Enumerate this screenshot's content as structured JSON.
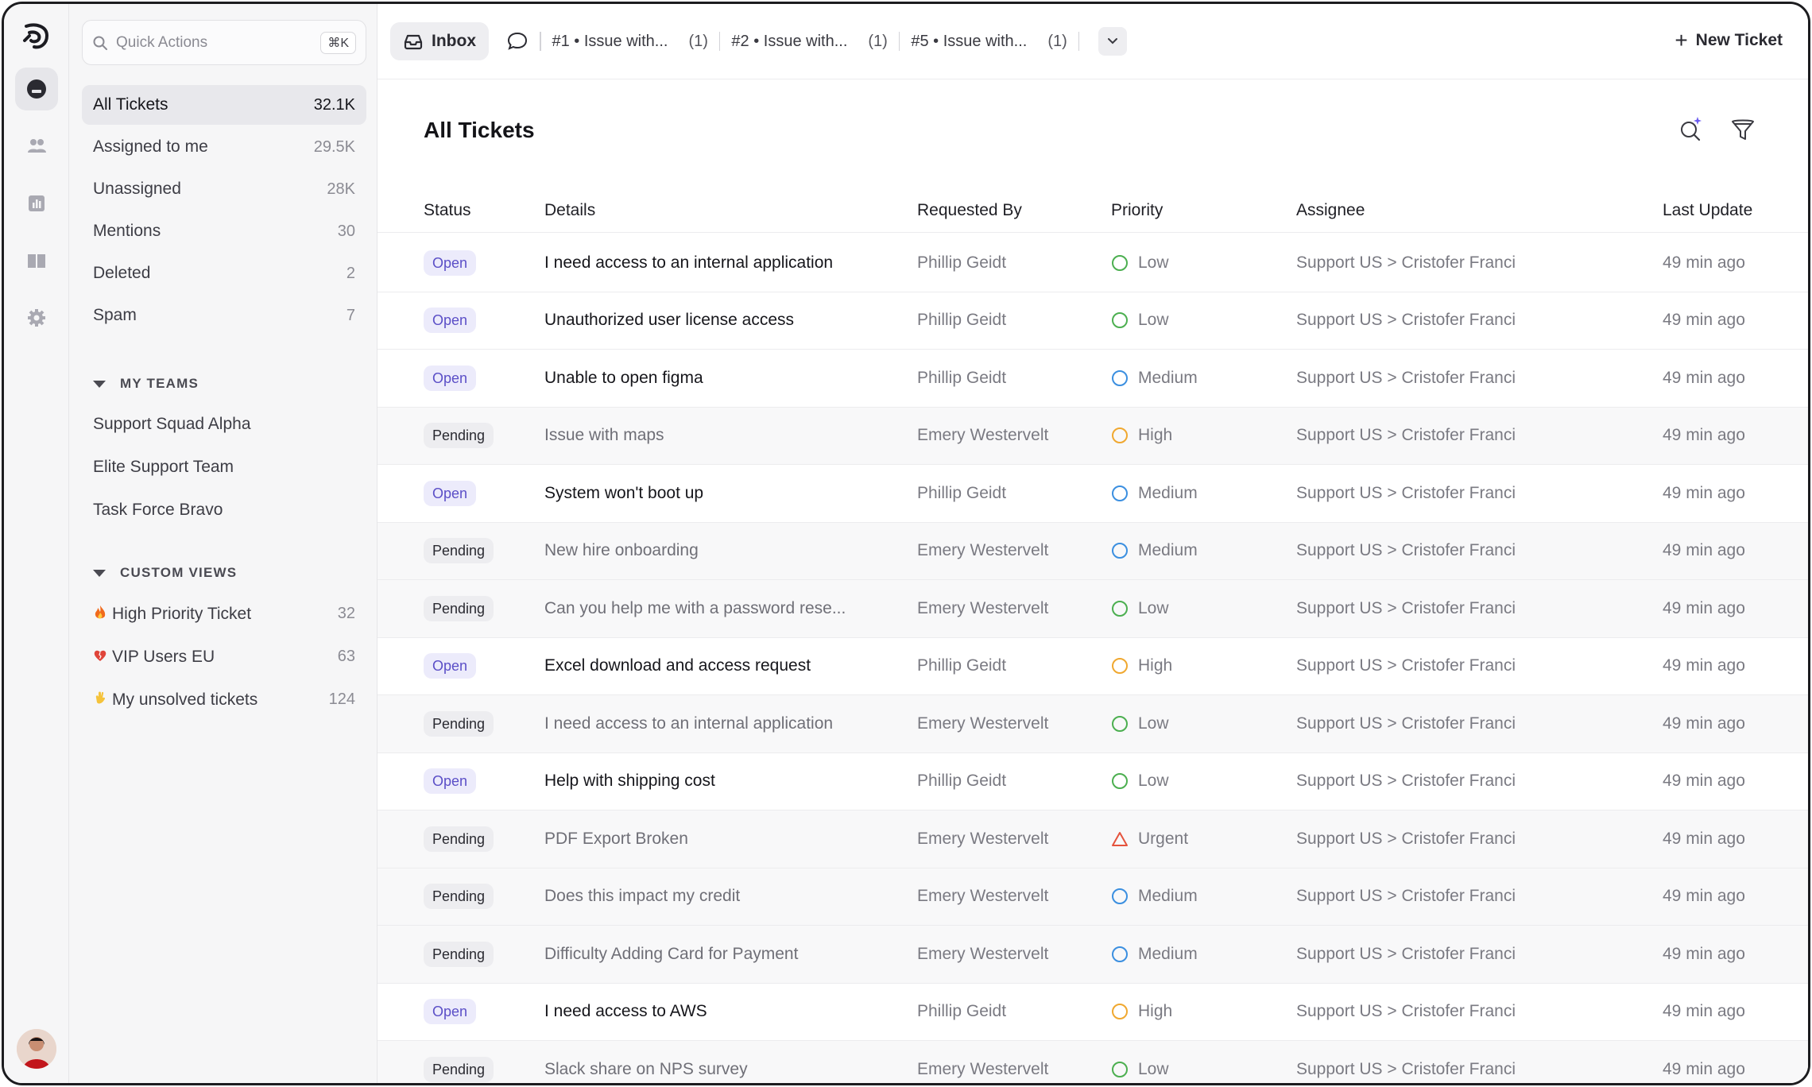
{
  "sidebar": {
    "search_placeholder": "Quick Actions",
    "search_shortcut": "⌘K",
    "items": [
      {
        "label": "All Tickets",
        "count": "32.1K"
      },
      {
        "label": "Assigned to me",
        "count": "29.5K"
      },
      {
        "label": "Unassigned",
        "count": "28K"
      },
      {
        "label": "Mentions",
        "count": "30"
      },
      {
        "label": "Deleted",
        "count": "2"
      },
      {
        "label": "Spam",
        "count": "7"
      }
    ],
    "teams_heading": "MY TEAMS",
    "teams": [
      "Support Squad Alpha",
      "Elite Support Team",
      "Task Force Bravo"
    ],
    "views_heading": "CUSTOM VIEWS",
    "views": [
      {
        "label": "High Priority Ticket",
        "count": "32",
        "icon": "fire-emoji-icon"
      },
      {
        "label": "VIP Users EU",
        "count": "63",
        "icon": "heart-emoji-icon"
      },
      {
        "label": "My unsolved tickets",
        "count": "124",
        "icon": "wave-emoji-icon"
      }
    ]
  },
  "topbar": {
    "inbox_label": "Inbox",
    "tabs": [
      {
        "label": "#1 • Issue with...",
        "count": "(1)"
      },
      {
        "label": "#2 • Issue with...",
        "count": "(1)"
      },
      {
        "label": "#5 • Issue with...",
        "count": "(1)"
      }
    ],
    "new_ticket_label": "New Ticket"
  },
  "main": {
    "title": "All Tickets",
    "columns": {
      "status": "Status",
      "details": "Details",
      "requested_by": "Requested By",
      "priority": "Priority",
      "assignee": "Assignee",
      "last_update": "Last Update"
    },
    "priority_colors": {
      "Low": "#4caf50",
      "Medium": "#3b8fe0",
      "High": "#f0a830",
      "Urgent": "#e5533d"
    },
    "status_colors": {
      "Open": "#5b4fc7",
      "Pending": "#2a2a31"
    },
    "rows": [
      {
        "status": "Open",
        "details": "I need access to an internal application",
        "requester": "Phillip Geidt",
        "priority": "Low",
        "assignee": "Support US > Cristofer Franci",
        "updated": "49 min ago"
      },
      {
        "status": "Open",
        "details": "Unauthorized user license access",
        "requester": "Phillip Geidt",
        "priority": "Low",
        "assignee": "Support US > Cristofer Franci",
        "updated": "49 min ago"
      },
      {
        "status": "Open",
        "details": "Unable to open figma",
        "requester": "Phillip Geidt",
        "priority": "Medium",
        "assignee": "Support US > Cristofer Franci",
        "updated": "49 min ago"
      },
      {
        "status": "Pending",
        "details": "Issue with maps",
        "requester": "Emery Westervelt",
        "priority": "High",
        "assignee": "Support US > Cristofer Franci",
        "updated": "49 min ago"
      },
      {
        "status": "Open",
        "details": "System won't boot up",
        "requester": "Phillip Geidt",
        "priority": "Medium",
        "assignee": "Support US > Cristofer Franci",
        "updated": "49 min ago"
      },
      {
        "status": "Pending",
        "details": "New hire onboarding",
        "requester": "Emery Westervelt",
        "priority": "Medium",
        "assignee": "Support US > Cristofer Franci",
        "updated": "49 min ago"
      },
      {
        "status": "Pending",
        "details": "Can you help me with a password rese...",
        "requester": "Emery Westervelt",
        "priority": "Low",
        "assignee": "Support US > Cristofer Franci",
        "updated": "49 min ago"
      },
      {
        "status": "Open",
        "details": "Excel download and access request",
        "requester": "Phillip Geidt",
        "priority": "High",
        "assignee": "Support US > Cristofer Franci",
        "updated": "49 min ago"
      },
      {
        "status": "Pending",
        "details": "I need access to an internal application",
        "requester": "Emery Westervelt",
        "priority": "Low",
        "assignee": "Support US > Cristofer Franci",
        "updated": "49 min ago"
      },
      {
        "status": "Open",
        "details": "Help with shipping cost",
        "requester": "Phillip Geidt",
        "priority": "Low",
        "assignee": "Support US > Cristofer Franci",
        "updated": "49 min ago"
      },
      {
        "status": "Pending",
        "details": "PDF Export Broken",
        "requester": "Emery Westervelt",
        "priority": "Urgent",
        "assignee": "Support US > Cristofer Franci",
        "updated": "49 min ago"
      },
      {
        "status": "Pending",
        "details": "Does this impact my credit",
        "requester": "Emery Westervelt",
        "priority": "Medium",
        "assignee": "Support US > Cristofer Franci",
        "updated": "49 min ago"
      },
      {
        "status": "Pending",
        "details": "Difficulty Adding Card for Payment",
        "requester": "Emery Westervelt",
        "priority": "Medium",
        "assignee": "Support US > Cristofer Franci",
        "updated": "49 min ago"
      },
      {
        "status": "Open",
        "details": "I need access to AWS",
        "requester": "Phillip Geidt",
        "priority": "High",
        "assignee": "Support US > Cristofer Franci",
        "updated": "49 min ago"
      },
      {
        "status": "Pending",
        "details": "Slack share on NPS survey",
        "requester": "Emery Westervelt",
        "priority": "Low",
        "assignee": "Support US > Cristofer Franci",
        "updated": "49 min ago"
      }
    ]
  }
}
